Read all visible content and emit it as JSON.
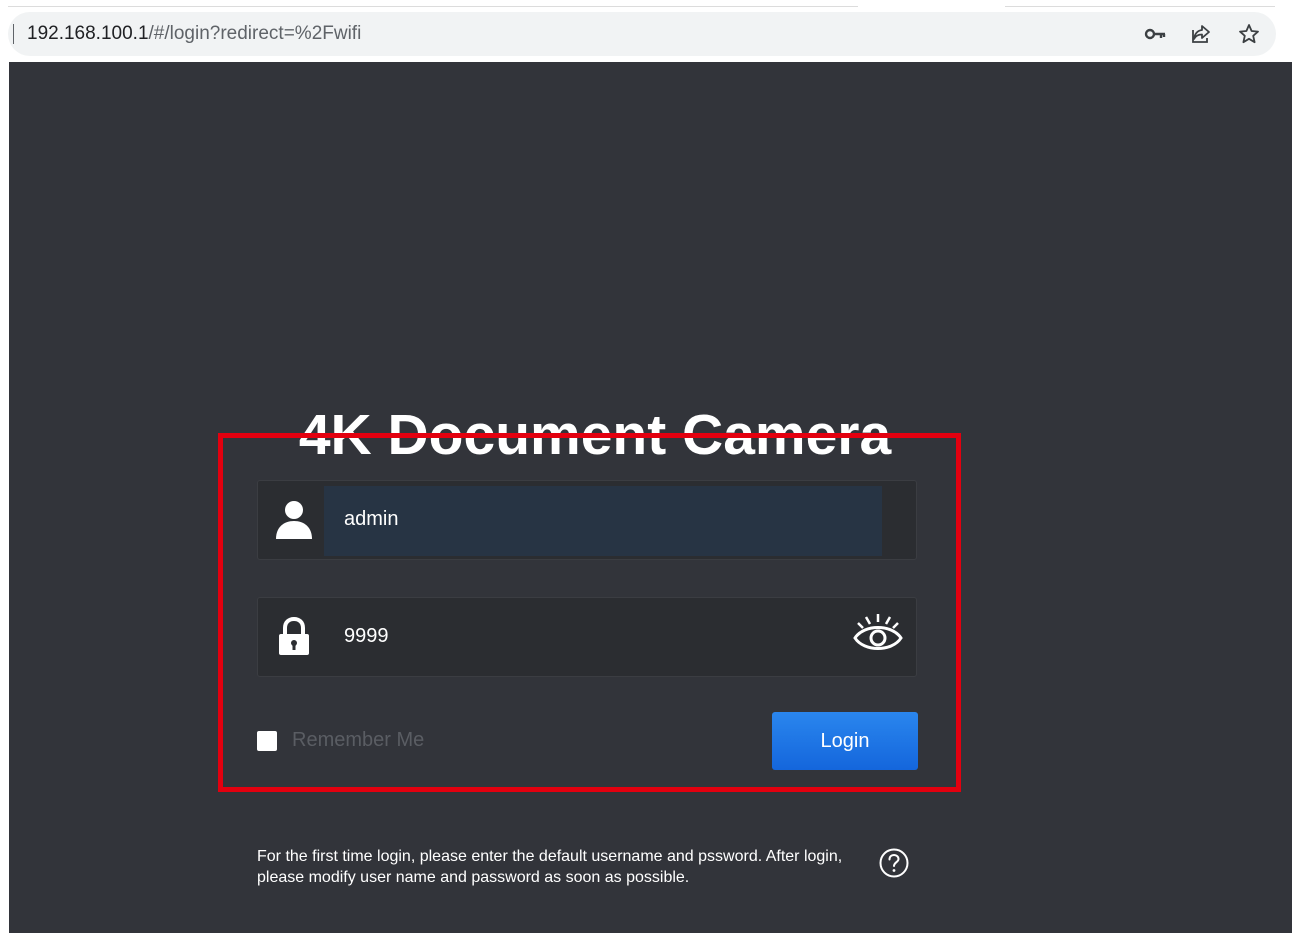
{
  "browser": {
    "url_host": "192.168.100.1",
    "url_path": "/#/login?redirect=%2Fwifi",
    "icons": [
      "key-icon",
      "share-icon",
      "star-icon"
    ]
  },
  "login": {
    "title": "4K Document Camera",
    "username_value": "admin",
    "password_value": "9999",
    "remember_label": "Remember Me",
    "login_label": "Login",
    "help_text": "For the first time login, please enter the default username and pssword. After login, please modify user name and password as soon as possible.",
    "icons": [
      "user-icon",
      "lock-icon",
      "eye-icon",
      "help-icon"
    ]
  },
  "colors": {
    "background": "#32343a",
    "highlight": "#e3000f",
    "login_button": "#1f75e6"
  }
}
